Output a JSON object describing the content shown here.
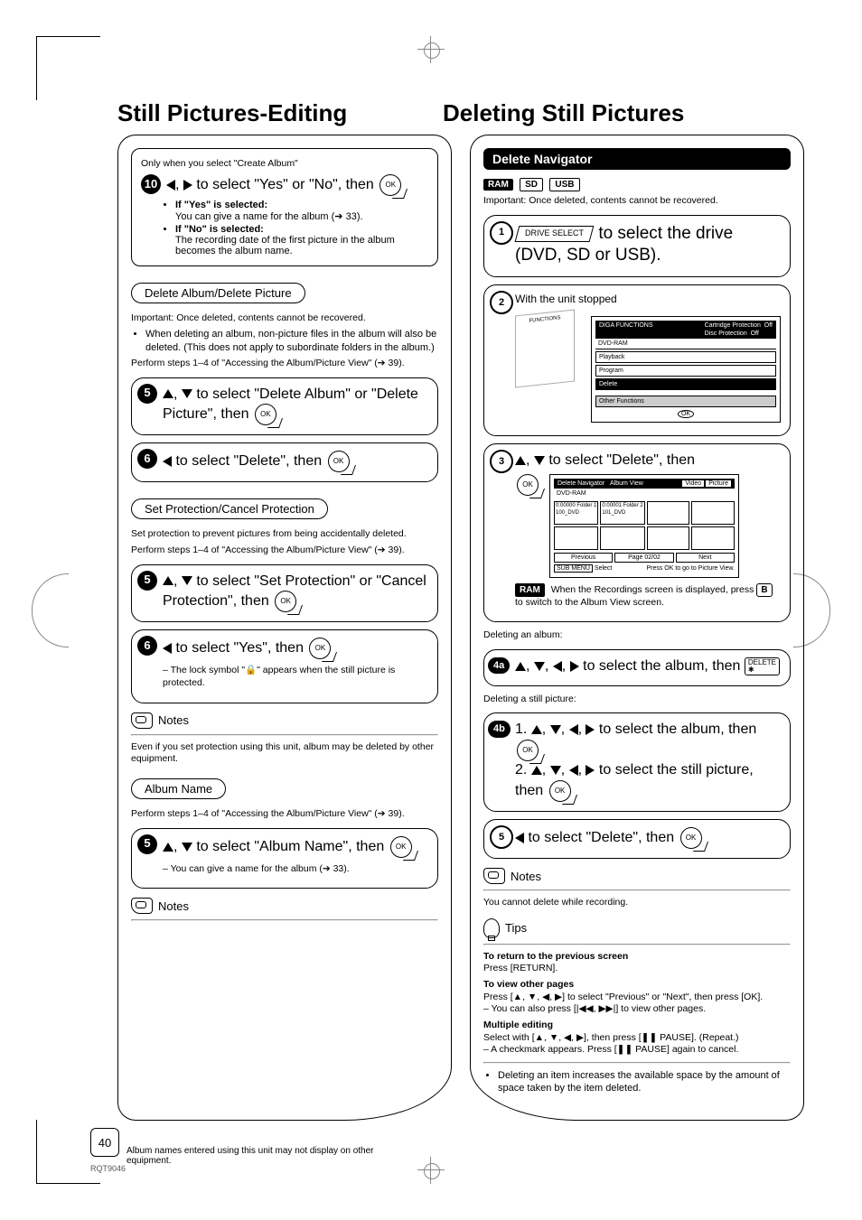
{
  "titles": {
    "left": "Still Pictures-Editing",
    "right": "Deleting Still Pictures"
  },
  "left_col": {
    "box_top": "Only when you select \"Create Album\"",
    "step10": "◀, ▶ to select \"Yes\" or \"No\", then",
    "if_yes_head": "If \"Yes\" is selected:",
    "if_yes_body": "You can give a name for the album (➔ 33).",
    "if_no_head": "If \"No\" is selected:",
    "if_no_body": "The recording date of the first picture in the album becomes the album name.",
    "delete_album_pill": "Delete Album/Delete Picture",
    "delete_important": "Important: Once deleted, contents cannot be recovered.",
    "delete_bullet": "When deleting an album, non-picture files in the album will also be deleted. (This does not apply to subordinate folders in the album.)",
    "delete_perform": "Perform steps 1–4 of \"Accessing the Album/Picture View\" (➔ 39).",
    "step5a": "▲, ▼ to select \"Delete Album\" or \"Delete Picture\", then",
    "step6a": "◀ to select \"Delete\", then",
    "setprot_pill": "Set Protection/Cancel Protection",
    "setprot_body1": "Set protection to prevent pictures from being accidentally deleted.",
    "setprot_body2": "Perform steps 1–4 of \"Accessing the Album/Picture View\" (➔ 39).",
    "step5b": "▲, ▼ to select \"Set Protection\" or \"Cancel Protection\", then",
    "step6b": "◀ to select \"Yes\", then",
    "lock_note": "– The lock symbol \"🔒\" appears when the still picture is protected.",
    "notes1": "Notes",
    "notes1_body": "Even if you set protection using this unit, album may be deleted by other equipment.",
    "albumname_pill": "Album Name",
    "albumname_body": "Perform steps 1–4 of \"Accessing the Album/Picture View\" (➔ 39).",
    "step5c": "▲, ▼ to select \"Album Name\", then",
    "step5c_sub": "– You can give a name for the album (➔ 33).",
    "notes2": "Notes",
    "notes2_body": "Album names entered using this unit may not display on other equipment."
  },
  "right_col": {
    "nav_title": "Delete Navigator",
    "badges": [
      "RAM",
      "SD",
      "USB"
    ],
    "important": "Important: Once deleted, contents cannot be recovered.",
    "step1_btn": "DRIVE SELECT",
    "step1_text": "to select the drive (DVD, SD or USB).",
    "step2_head": "With the unit stopped",
    "func_label": "FUNCTIONS",
    "osd1": {
      "brand": "DIGA  FUNCTIONS",
      "top_r": "Cartridge Protection  Off\nDisc Protection  Off",
      "disc": "DVD-RAM",
      "items": [
        "Playback",
        "Program",
        "Delete",
        "Other Functions"
      ],
      "ok": "OK"
    },
    "step3": "▲, ▼ to select \"Delete\", then",
    "osd2": {
      "title": "Delete Navigator",
      "tab": "Album View",
      "disc": "DVD-RAM",
      "btns": [
        "Video",
        "Picture"
      ],
      "c1": "0:00000 Folder 1\n100_DVD",
      "c2": "0:00001 Folder 2\n101_DVD",
      "nav": [
        "Previous",
        "Page",
        "02/02",
        "Next"
      ],
      "hint": "Press OK to go to Picture View.",
      "subs": "SUB MENU",
      "sel": "Select"
    },
    "ram_note_pre": "When the Recordings screen is displayed, press",
    "ram_note_key": "B",
    "ram_note_post": "to switch to the Album View screen.",
    "del_album_head": "Deleting an album:",
    "step4a": "▲, ▼, ◀, ▶ to select the album, then",
    "del_key": "DELETE\n✱",
    "del_still_head": "Deleting a still picture:",
    "step4b1": "1. ▲, ▼, ◀, ▶ to select the album, then",
    "step4b2": "2. ▲, ▼, ◀, ▶ to select the still picture, then",
    "step5": "◀ to select \"Delete\", then",
    "notes": "Notes",
    "notes_body": "You cannot delete while recording.",
    "tips": "Tips",
    "tip1_h": "To return to the previous screen",
    "tip1_b": "Press [RETURN].",
    "tip2_h": "To view other pages",
    "tip2_b1": "Press [▲, ▼, ◀, ▶] to select \"Previous\" or \"Next\", then press [OK].",
    "tip2_b2": "– You can also press [|◀◀, ▶▶|] to view other pages.",
    "tip3_h": "Multiple editing",
    "tip3_b1": "Select with [▲, ▼, ◀, ▶], then press [❚❚ PAUSE]. (Repeat.)",
    "tip3_b2": "– A checkmark appears. Press [❚❚ PAUSE] again to cancel.",
    "final": "Deleting an item increases the available space by the amount of space taken by the item deleted."
  },
  "page_number": "40",
  "rqt": "RQT9046"
}
